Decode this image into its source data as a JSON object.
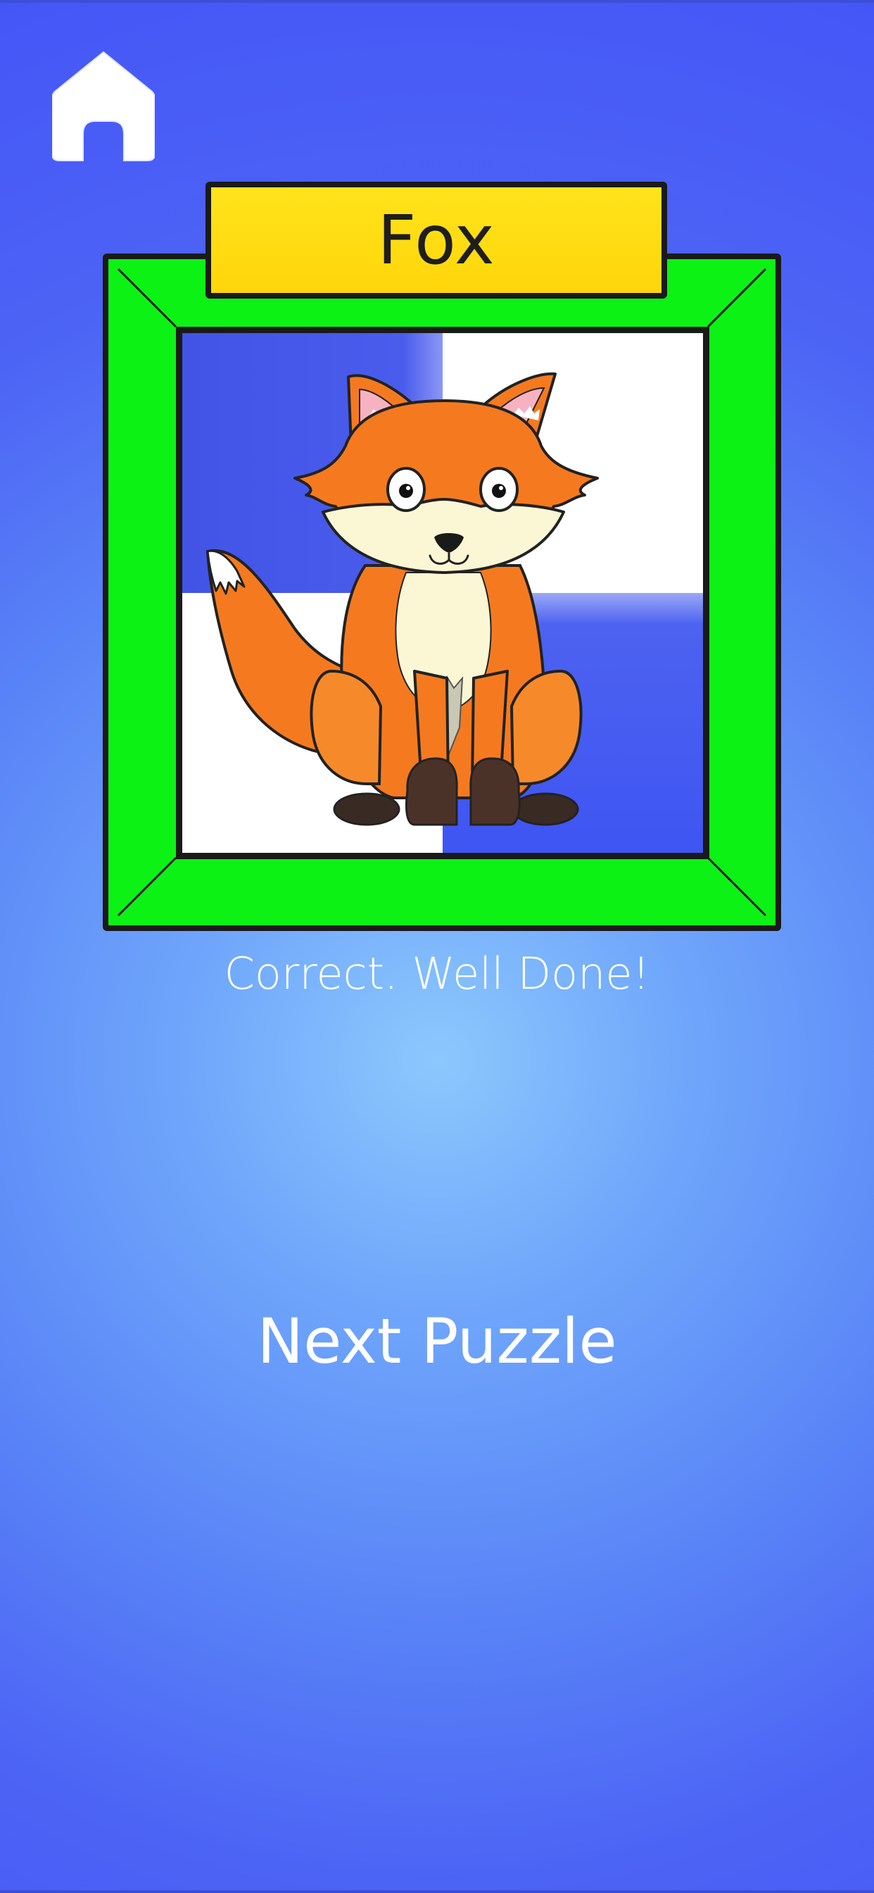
{
  "puzzle": {
    "animal_name": "Fox",
    "feedback": "Correct. Well Done!"
  },
  "actions": {
    "next_label": "Next Puzzle"
  },
  "icons": {
    "home": "home-icon"
  },
  "colors": {
    "background": "#4c63f5",
    "frame": "#0cf215",
    "plaque": "#ffd60a",
    "fox_orange": "#f57a1f",
    "fox_cream": "#fbf7d5"
  }
}
